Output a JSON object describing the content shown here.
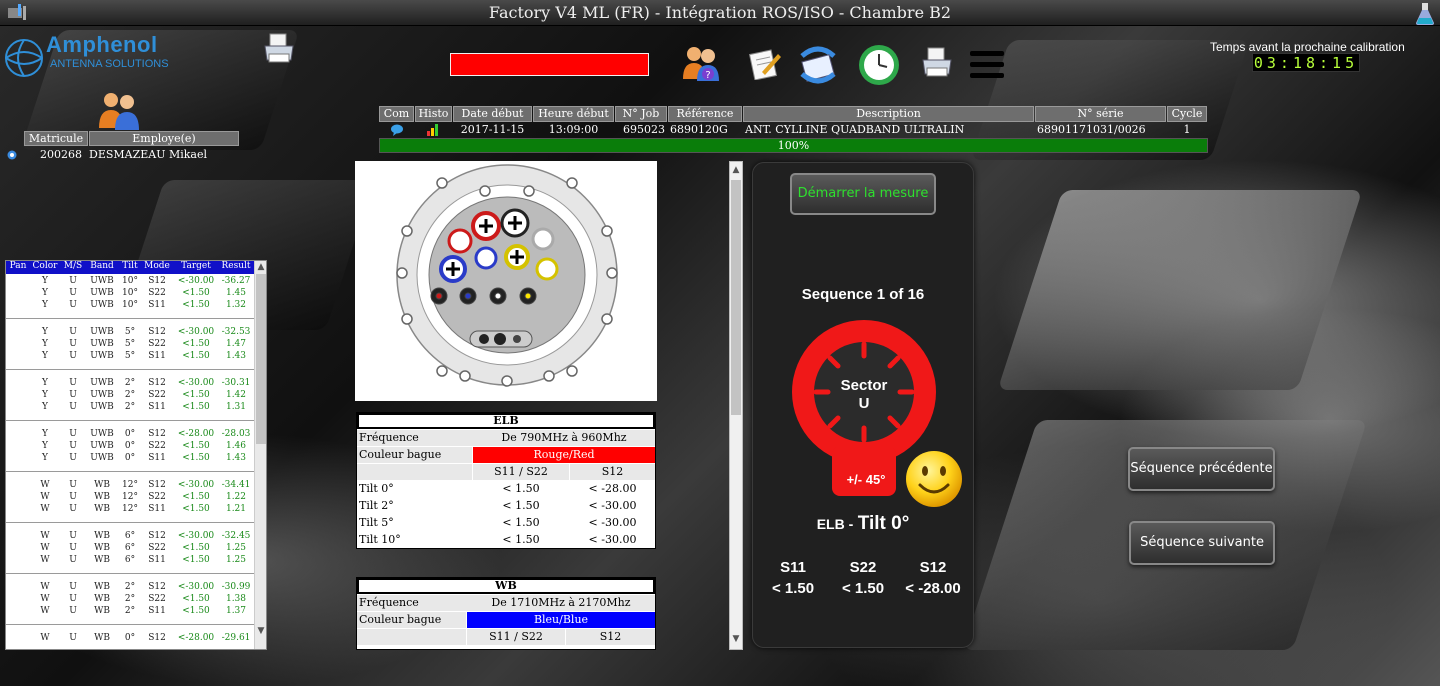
{
  "window": {
    "title": "Factory V4 ML (FR) - Intégration ROS/ISO - Chambre B2"
  },
  "logo": {
    "name": "Amphenol",
    "subtitle": "ANTENNA SOLUTIONS"
  },
  "toolbar": {
    "icons": [
      "printer-icon",
      "user-help-icon",
      "document-edit-icon",
      "mail-refresh-icon",
      "clock-icon",
      "printer-icon",
      "menu-icon"
    ]
  },
  "calibration": {
    "label": "Temps avant la prochaine calibration",
    "timer": "03:18:15"
  },
  "employee": {
    "headers": [
      "Matricule",
      "Employe(e)"
    ],
    "matricule": "200268",
    "name": "DESMAZEAU Mikael"
  },
  "job": {
    "headers": [
      "Com",
      "Histo",
      "Date début",
      "Heure début",
      "N° Job",
      "Référence",
      "Description",
      "N° série",
      "Cycle"
    ],
    "date": "2017-11-15",
    "time": "13:09:00",
    "job_number": "695023",
    "reference": "6890120G",
    "description": "ANT. CYLLINE QUADBAND ULTRALIN",
    "serial": "68901171031/0026",
    "cycle": "1",
    "progress_text": "100%",
    "progress_value": 1.0
  },
  "results": {
    "headers": [
      "Pan",
      "Color",
      "M/S",
      "Band",
      "Tilt",
      "Mode",
      "Target",
      "Result"
    ],
    "groups": [
      [
        [
          "Y",
          "U",
          "UWB",
          "10°",
          "S12",
          "<-30.00",
          "-36.27"
        ],
        [
          "Y",
          "U",
          "UWB",
          "10°",
          "S22",
          "<1.50",
          "1.45"
        ],
        [
          "Y",
          "U",
          "UWB",
          "10°",
          "S11",
          "<1.50",
          "1.32"
        ]
      ],
      [
        [
          "Y",
          "U",
          "UWB",
          "5°",
          "S12",
          "<-30.00",
          "-32.53"
        ],
        [
          "Y",
          "U",
          "UWB",
          "5°",
          "S22",
          "<1.50",
          "1.47"
        ],
        [
          "Y",
          "U",
          "UWB",
          "5°",
          "S11",
          "<1.50",
          "1.43"
        ]
      ],
      [
        [
          "Y",
          "U",
          "UWB",
          "2°",
          "S12",
          "<-30.00",
          "-30.31"
        ],
        [
          "Y",
          "U",
          "UWB",
          "2°",
          "S22",
          "<1.50",
          "1.42"
        ],
        [
          "Y",
          "U",
          "UWB",
          "2°",
          "S11",
          "<1.50",
          "1.31"
        ]
      ],
      [
        [
          "Y",
          "U",
          "UWB",
          "0°",
          "S12",
          "<-28.00",
          "-28.03"
        ],
        [
          "Y",
          "U",
          "UWB",
          "0°",
          "S22",
          "<1.50",
          "1.46"
        ],
        [
          "Y",
          "U",
          "UWB",
          "0°",
          "S11",
          "<1.50",
          "1.43"
        ]
      ],
      [
        [
          "W",
          "U",
          "WB",
          "12°",
          "S12",
          "<-30.00",
          "-34.41"
        ],
        [
          "W",
          "U",
          "WB",
          "12°",
          "S22",
          "<1.50",
          "1.22"
        ],
        [
          "W",
          "U",
          "WB",
          "12°",
          "S11",
          "<1.50",
          "1.21"
        ]
      ],
      [
        [
          "W",
          "U",
          "WB",
          "6°",
          "S12",
          "<-30.00",
          "-32.45"
        ],
        [
          "W",
          "U",
          "WB",
          "6°",
          "S22",
          "<1.50",
          "1.25"
        ],
        [
          "W",
          "U",
          "WB",
          "6°",
          "S11",
          "<1.50",
          "1.25"
        ]
      ],
      [
        [
          "W",
          "U",
          "WB",
          "2°",
          "S12",
          "<-30.00",
          "-30.99"
        ],
        [
          "W",
          "U",
          "WB",
          "2°",
          "S22",
          "<1.50",
          "1.38"
        ],
        [
          "W",
          "U",
          "WB",
          "2°",
          "S11",
          "<1.50",
          "1.37"
        ]
      ],
      [
        [
          "W",
          "U",
          "WB",
          "0°",
          "S12",
          "<-28.00",
          "-29.61"
        ]
      ]
    ]
  },
  "spec_elb": {
    "title": "ELB",
    "freq_label": "Fréquence",
    "freq_value": "De 790MHz à 960Mhz",
    "color_label": "Couleur bague",
    "color_value": "Rouge/Red",
    "color_hex": "#ff0000",
    "col1": "S11 / S22",
    "col2": "S12",
    "rows": [
      [
        "Tilt 0°",
        "< 1.50",
        "< -28.00"
      ],
      [
        "Tilt 2°",
        "< 1.50",
        "< -30.00"
      ],
      [
        "Tilt 5°",
        "< 1.50",
        "< -30.00"
      ],
      [
        "Tilt 10°",
        "< 1.50",
        "< -30.00"
      ]
    ]
  },
  "spec_wb": {
    "title": "WB",
    "freq_label": "Fréquence",
    "freq_value": "De 1710MHz à 2170Mhz",
    "color_label": "Couleur bague",
    "color_value": "Bleu/Blue",
    "color_hex": "#0000ff",
    "col1": "S11 / S22",
    "col2": "S12"
  },
  "sequence": {
    "start_button": "Démarrer la mesure",
    "label": "Sequence 1 of 16",
    "sector_line1": "Sector",
    "sector_line2": "U",
    "tolerance": "+/- 45°",
    "band": "ELB -",
    "tilt": "Tilt 0°",
    "measures": [
      {
        "name": "S11",
        "value": "< 1.50"
      },
      {
        "name": "S22",
        "value": "< 1.50"
      },
      {
        "name": "S12",
        "value": "< -28.00"
      }
    ],
    "prev_button": "Séquence précédente",
    "next_button": "Séquence suivante"
  }
}
